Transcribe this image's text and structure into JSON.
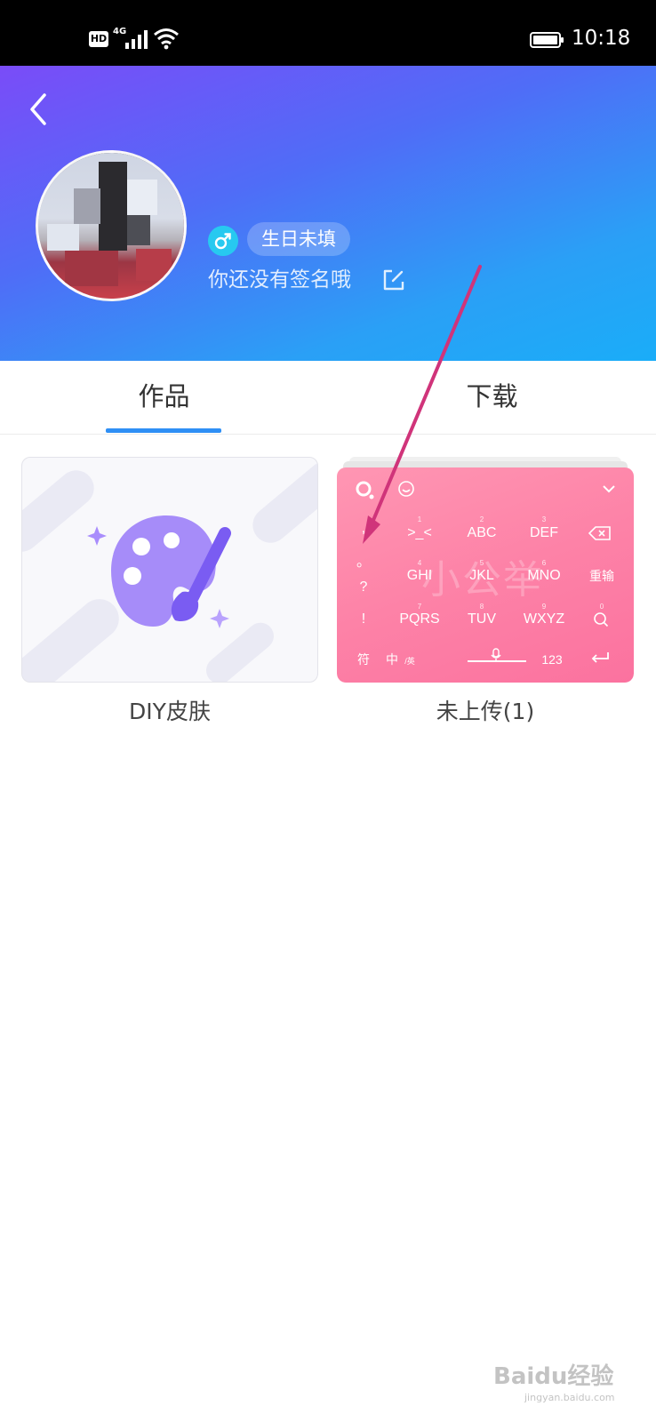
{
  "status_bar": {
    "network": "HD",
    "network_type": "4G",
    "time": "10:18",
    "icons": [
      "signal-icon",
      "wifi-icon",
      "battery-icon"
    ]
  },
  "profile": {
    "gender_icon": "male-icon",
    "birthday": "生日未填",
    "signature": "你还没有签名哦",
    "edit_icon": "edit-icon",
    "back_icon": "back-arrow-icon"
  },
  "tabs": [
    {
      "label": "作品",
      "active": true
    },
    {
      "label": "下载",
      "active": false
    }
  ],
  "cards": {
    "diy": {
      "label": "DIY皮肤",
      "icon": "palette-brush-icon"
    },
    "upload": {
      "label": "未上传(1)"
    }
  },
  "keyboard_preview": {
    "watermark": "小公举",
    "row1": {
      "keys": [
        ">_<",
        "ABC",
        "DEF"
      ],
      "nums": [
        "1",
        "2",
        "3"
      ]
    },
    "row2": {
      "keys": [
        "GHI",
        "JKL",
        "MNO",
        "重输"
      ],
      "nums": [
        "4",
        "5",
        "6"
      ]
    },
    "row3": {
      "keys": [
        "PQRS",
        "TUV",
        "WXYZ"
      ],
      "nums": [
        "7",
        "8",
        "9",
        "0"
      ]
    },
    "side_keys": [
      ",",
      "。",
      "?",
      "!"
    ],
    "bottom": {
      "symbol": "符",
      "lang": "中",
      "lang_sub": "/英",
      "numbers": "123"
    }
  },
  "colors": {
    "header_start": "#7a4cf8",
    "header_end": "#1aadf8",
    "tab_indicator": "#2f8ff5",
    "keyboard_pink": "#fd82a7",
    "annotation_arrow": "#d0347a"
  },
  "watermark": {
    "text": "Baidu经验",
    "url": "jingyan.baidu.com"
  }
}
